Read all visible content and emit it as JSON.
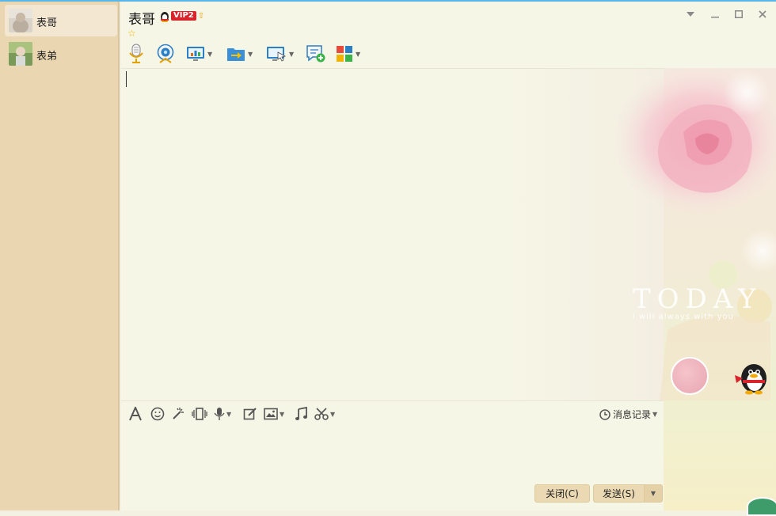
{
  "contacts": [
    {
      "name": "表哥",
      "active": true
    },
    {
      "name": "表弟",
      "active": false
    }
  ],
  "chat": {
    "title": "表哥",
    "vip_label": "VIP2"
  },
  "input_toolbar": {
    "history_label": "消息记录"
  },
  "buttons": {
    "close_label": "关闭(C)",
    "send_label": "发送(S)"
  },
  "wallpaper": {
    "today_text": "TODAY",
    "today_subtext": "i will always with you"
  },
  "colors": {
    "sidebar_bg": "#ead6b0",
    "chat_bg": "#f6f6e6",
    "vip_red": "#d8242b",
    "button_bg": "#ead9b2",
    "accent_blue": "#59b6e8"
  }
}
